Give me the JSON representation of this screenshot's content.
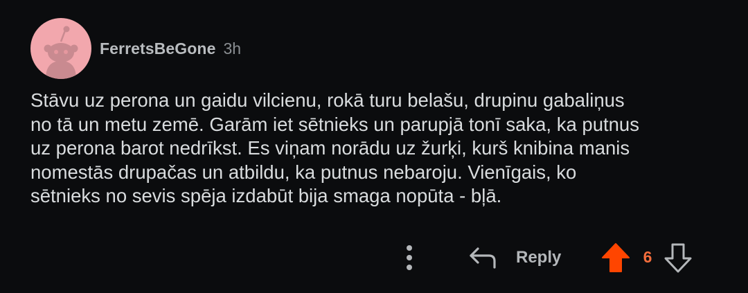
{
  "comment": {
    "author": "FerretsBeGone",
    "time_ago": "3h",
    "avatar_icon": "snoo-avatar-icon",
    "avatar_color": "#f2a7ad",
    "body_lines": [
      "Stāvu uz perona un gaidu vilcienu, rokā turu belašu, drupinu gabaliņus",
      "no tā un metu zemē. Garām iet sētnieks un parupjā tonī saka, ka putnus",
      "uz perona barot nedrīkst. Es viņam norādu uz žurķi, kurš knibina manis",
      "nomestās drupačas un atbildu, ka putnus nebaroju. Vienīgais, ko",
      "sētnieks no sevis spēja izdabūt bija smaga nopūta - bļā."
    ]
  },
  "actions": {
    "more_icon": "more-vertical-icon",
    "reply_icon": "reply-arrow-icon",
    "reply_label": "Reply",
    "upvote_icon": "upvote-arrow-icon",
    "upvote_color": "#ff4500",
    "vote_count": "6",
    "vote_count_color": "#f36d3c",
    "downvote_icon": "downvote-arrow-icon"
  }
}
